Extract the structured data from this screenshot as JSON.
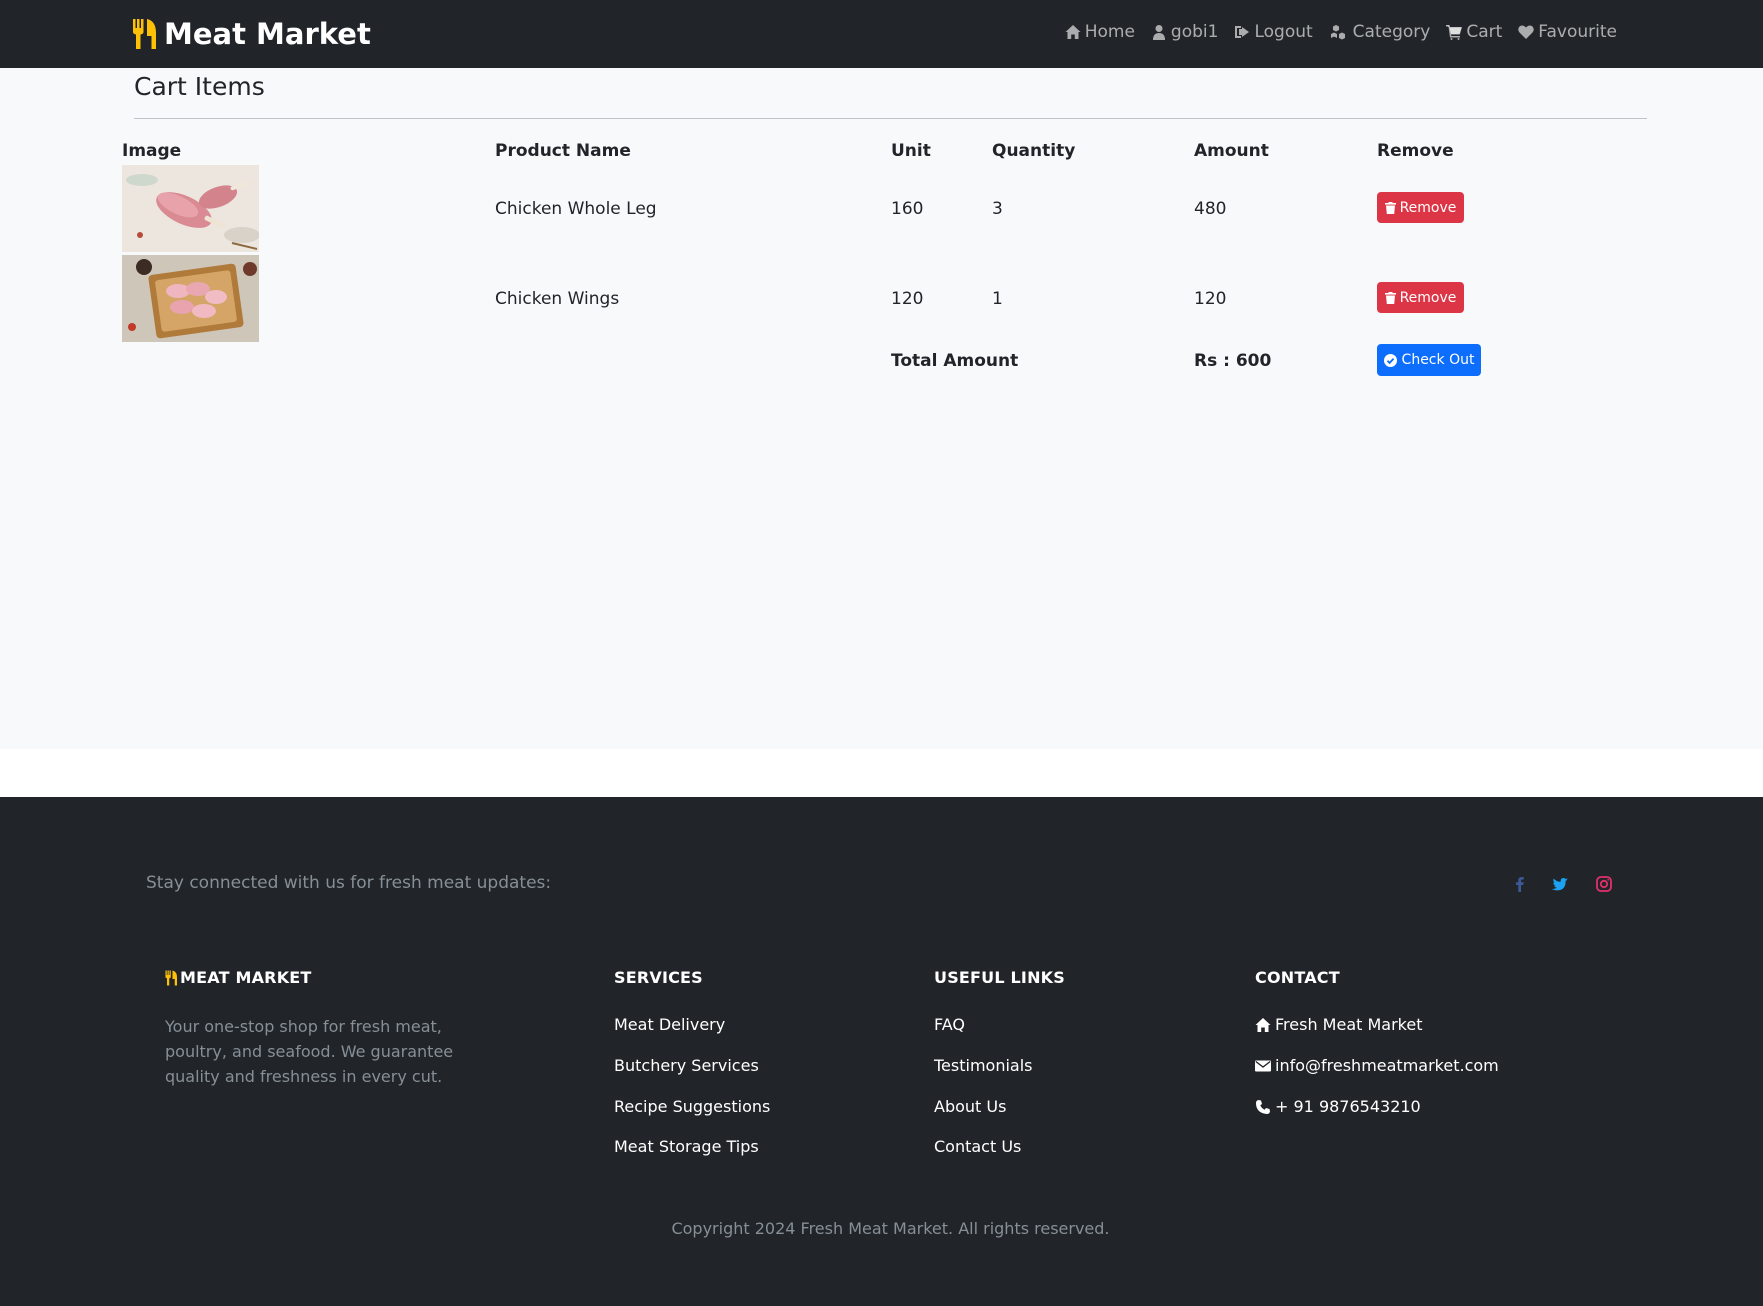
{
  "navbar": {
    "brand": "Meat Market",
    "logo_icon": "utensils-icon",
    "items": [
      {
        "label": "Home",
        "icon": "home-icon"
      },
      {
        "label": "gobi1",
        "icon": "user-icon"
      },
      {
        "label": "Logout",
        "icon": "sign-out-icon"
      },
      {
        "label": "Category",
        "icon": "cubes-icon"
      },
      {
        "label": "Cart",
        "icon": "cart-icon"
      },
      {
        "label": "Favourite",
        "icon": "heart-icon"
      }
    ]
  },
  "cart": {
    "title": "Cart Items",
    "headers": {
      "image": "Image",
      "product": "Product Name",
      "unit": "Unit",
      "quantity": "Quantity",
      "amount": "Amount",
      "remove": "Remove"
    },
    "rows": [
      {
        "product": "Chicken Whole Leg",
        "unit": "160",
        "quantity": "3",
        "amount": "480",
        "remove_label": "Remove"
      },
      {
        "product": "Chicken Wings",
        "unit": "120",
        "quantity": "1",
        "amount": "120",
        "remove_label": "Remove"
      }
    ],
    "total_label": "Total Amount",
    "total_value": "Rs : 600",
    "checkout_label": "Check Out"
  },
  "footer": {
    "stay_connected": "Stay connected with us for fresh meat updates:",
    "social": [
      {
        "icon": "facebook-icon",
        "color": "#3b5998"
      },
      {
        "icon": "twitter-icon",
        "color": "#1da1f2"
      },
      {
        "icon": "instagram-icon",
        "color": "#e1306c"
      }
    ],
    "brand_heading": "MEAT MARKET",
    "brand_description": "Your one-stop shop for fresh meat, poultry, and seafood. We guarantee quality and freshness in every cut.",
    "services_heading": "SERVICES",
    "services": [
      "Meat Delivery",
      "Butchery Services",
      "Recipe Suggestions",
      "Meat Storage Tips"
    ],
    "links_heading": "USEFUL LINKS",
    "links": [
      "FAQ",
      "Testimonials",
      "About Us",
      "Contact Us"
    ],
    "contact_heading": "CONTACT",
    "contact": {
      "name": "Fresh Meat Market",
      "email": "info@freshmeatmarket.com",
      "phone": "+ 91 9876543210"
    },
    "copyright": "Copyright 2024 Fresh Meat Market. All rights reserved."
  },
  "colors": {
    "navbar_bg": "#212529",
    "accent_yellow": "#ffc107",
    "remove_red": "#dc3545",
    "checkout_blue": "#0d6efd"
  }
}
